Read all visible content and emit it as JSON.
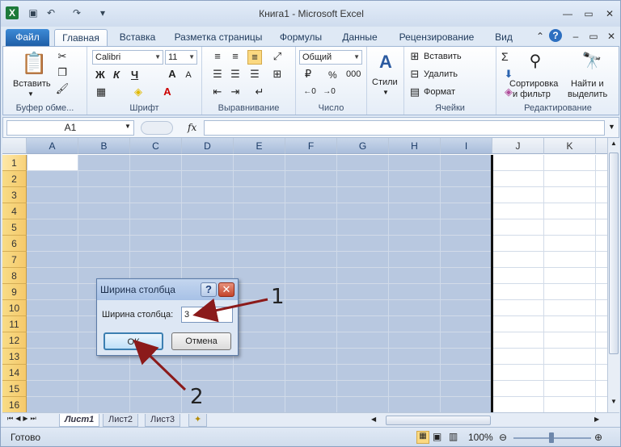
{
  "window": {
    "title": "Книга1 - Microsoft Excel"
  },
  "tabs": [
    "Файл",
    "Главная",
    "Вставка",
    "Разметка страницы",
    "Формулы",
    "Данные",
    "Рецензирование",
    "Вид"
  ],
  "ribbon": {
    "clipboard": {
      "label": "Буфер обме...",
      "paste": "Вставить"
    },
    "font": {
      "label": "Шрифт",
      "name": "Calibri",
      "size": "11",
      "bold": "Ж",
      "italic": "К",
      "underline": "Ч"
    },
    "alignment": {
      "label": "Выравнивание"
    },
    "number": {
      "label": "Число",
      "format": "Общий",
      "percent": "%",
      "thousands": "000"
    },
    "styles": {
      "label": "Стили"
    },
    "cells": {
      "label": "Ячейки",
      "insert": "Вставить",
      "delete": "Удалить",
      "format": "Формат"
    },
    "editing": {
      "label": "Редактирование",
      "sort1": "Сортировка",
      "sort2": "и фильтр",
      "find1": "Найти и",
      "find2": "выделить",
      "sum": "Σ"
    }
  },
  "formula_bar": {
    "name_box": "A1",
    "fx": "fx"
  },
  "columns": [
    "A",
    "B",
    "C",
    "D",
    "E",
    "F",
    "G",
    "H",
    "I",
    "J",
    "K"
  ],
  "rows": [
    "1",
    "2",
    "3",
    "4",
    "5",
    "6",
    "7",
    "8",
    "9",
    "10",
    "11",
    "12",
    "13",
    "14",
    "15",
    "16"
  ],
  "sheets": [
    "Лист1",
    "Лист2",
    "Лист3"
  ],
  "status": {
    "ready": "Готово",
    "zoom": "100%"
  },
  "dialog": {
    "title": "Ширина столбца",
    "help": "?",
    "close": "✕",
    "field_label": "Ширина столбца:",
    "field_value": "3",
    "ok": "ОК",
    "cancel": "Отмена"
  },
  "annotations": {
    "one": "1",
    "two": "2"
  },
  "colors": {
    "selection": "#b8c8e0",
    "arrow": "#8b1a1a",
    "file_tab": "#2a6fb6"
  }
}
